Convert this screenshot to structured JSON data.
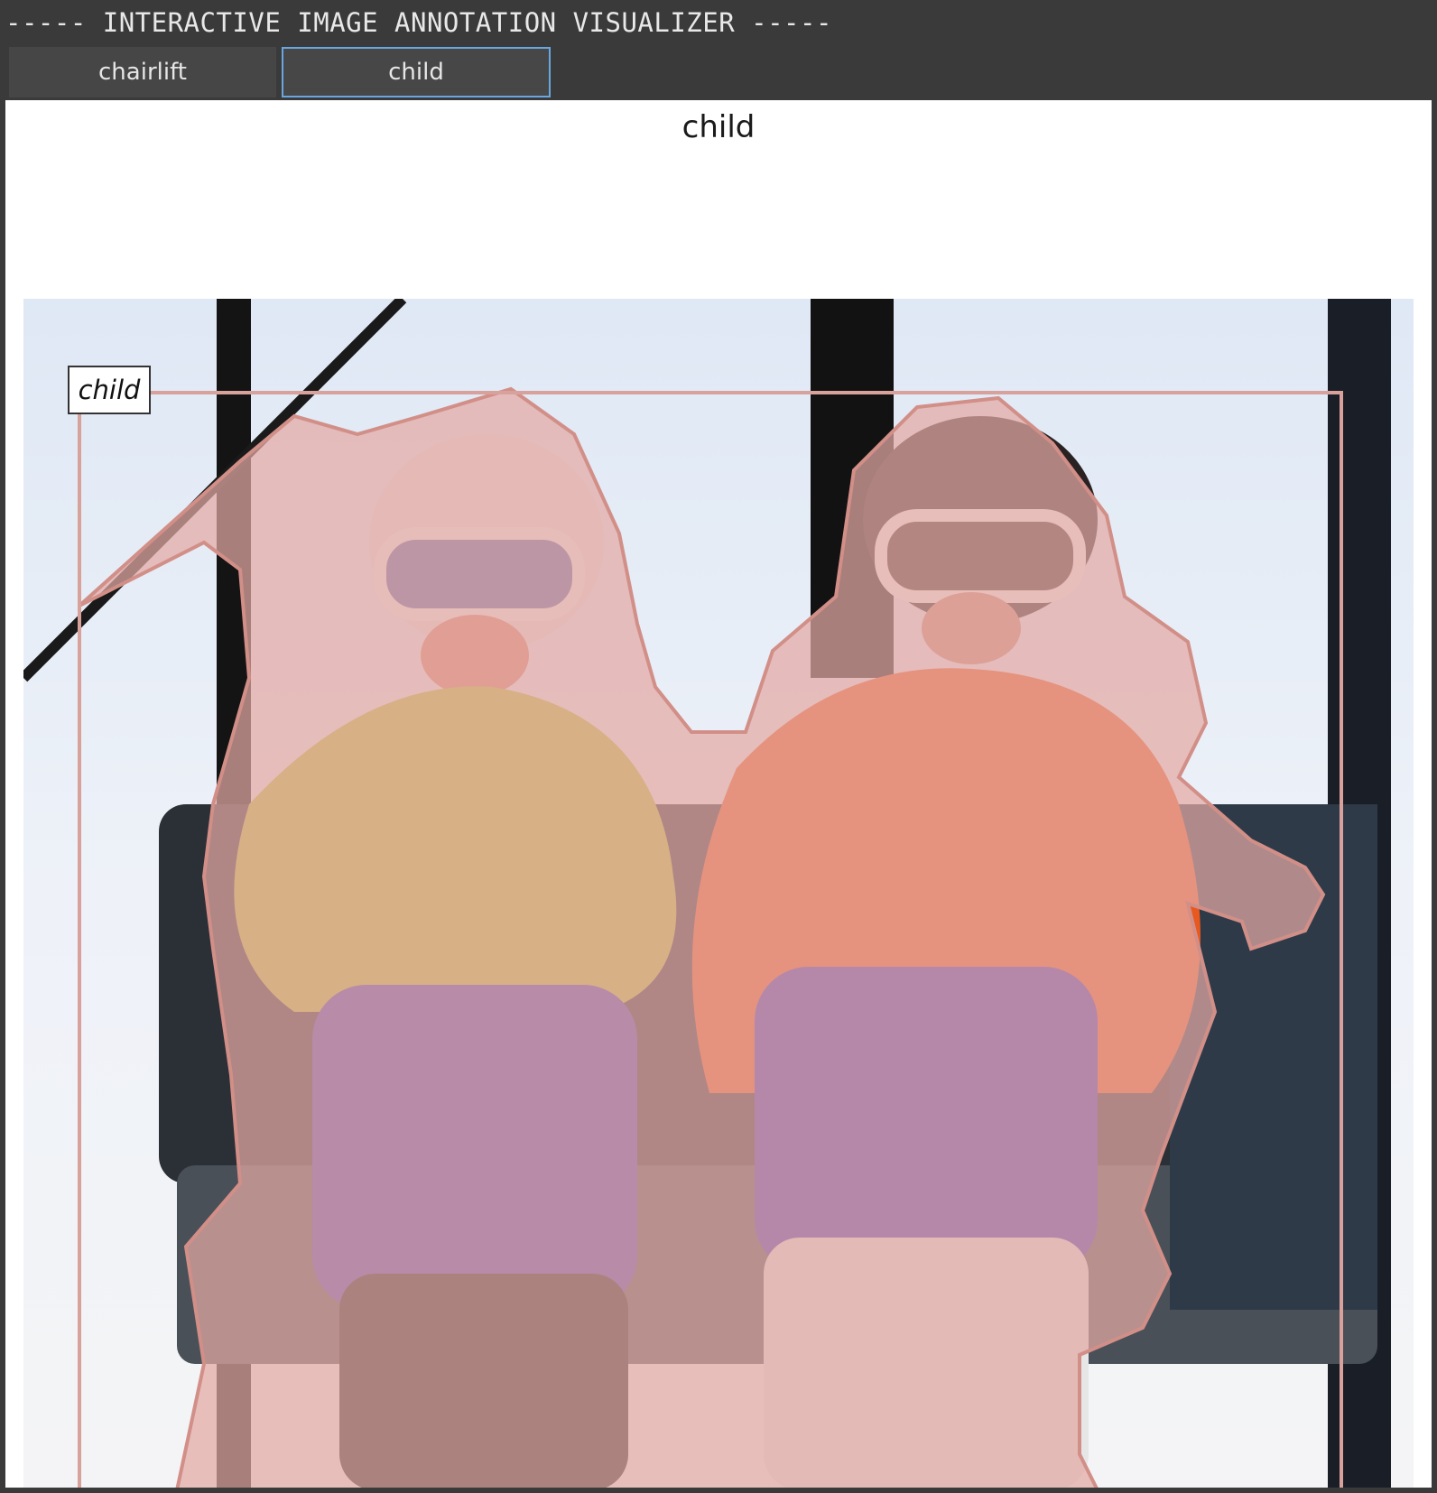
{
  "app": {
    "title": "----- INTERACTIVE IMAGE ANNOTATION VISUALIZER -----"
  },
  "tabs": [
    {
      "label": "chairlift",
      "selected": false
    },
    {
      "label": "child",
      "selected": true
    }
  ],
  "panel": {
    "title": "child",
    "annotation_label": "child"
  },
  "colors": {
    "window_bg": "#3a3a3a",
    "tab_bg": "#464646",
    "tab_selected_border": "#6aa7e0",
    "mask_fill": "#e3a9a3",
    "mask_outline": "#d28f88"
  }
}
